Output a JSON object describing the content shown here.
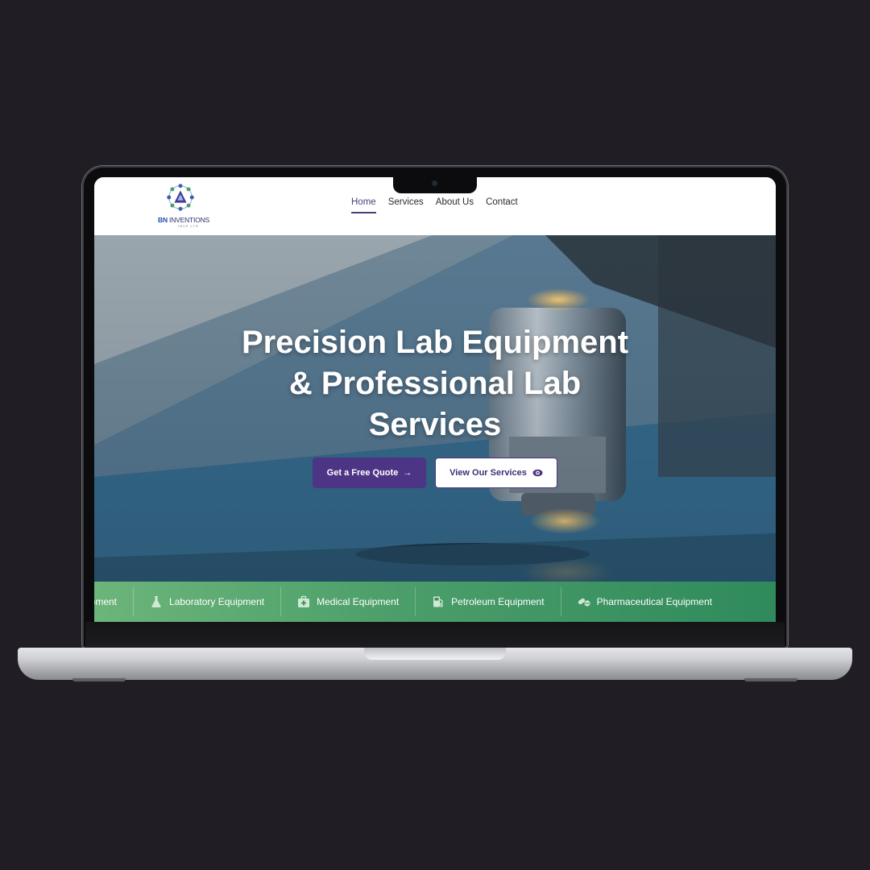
{
  "brand": {
    "name_bold": "BN",
    "name_rest": " INVENTIONS",
    "tagline": "INVS LTD"
  },
  "nav": {
    "items": [
      {
        "label": "Home",
        "active": true
      },
      {
        "label": "Services",
        "active": false
      },
      {
        "label": "About Us",
        "active": false
      },
      {
        "label": "Contact",
        "active": false
      }
    ]
  },
  "hero": {
    "title_lines": [
      "Precision Lab Equipment",
      "& Professional Lab",
      "Services"
    ],
    "primary_button": "Get a Free Quote",
    "secondary_button": "View Our Services"
  },
  "categories": {
    "items": [
      {
        "label": "ipment",
        "icon": "cropped-item"
      },
      {
        "label": "Laboratory Equipment",
        "icon": "flask-icon"
      },
      {
        "label": "Medical Equipment",
        "icon": "medical-kit-icon"
      },
      {
        "label": "Petroleum Equipment",
        "icon": "fuel-pump-icon"
      },
      {
        "label": "Pharmaceutical Equipment",
        "icon": "pills-icon"
      }
    ]
  },
  "colors": {
    "primary": "#4d3585",
    "strip_start": "#6cb57b",
    "strip_end": "#2f8a5c",
    "background": "#201d24"
  }
}
